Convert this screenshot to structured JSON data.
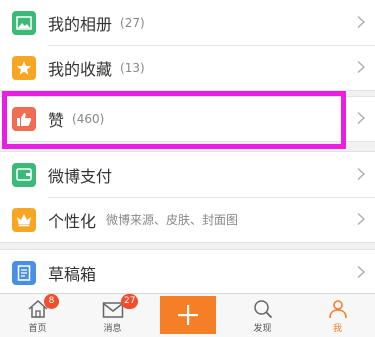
{
  "menu": {
    "album": {
      "label": "我的相册",
      "count": "(27)"
    },
    "favorites": {
      "label": "我的收藏",
      "count": "(13)"
    },
    "likes": {
      "label": "赞",
      "count": "(460)"
    },
    "payment": {
      "label": "微博支付"
    },
    "personalize": {
      "label": "个性化",
      "sub": "微博来源、皮肤、封面图"
    },
    "drafts": {
      "label": "草稿箱"
    }
  },
  "tabbar": {
    "home": {
      "label": "首页",
      "badge": "8"
    },
    "messages": {
      "label": "消息",
      "badge": "27"
    },
    "add": {
      "icon": "plus-icon"
    },
    "discover": {
      "label": "发现"
    },
    "me": {
      "label": "我"
    }
  },
  "colors": {
    "album": "#3cb878",
    "favorites": "#f6a623",
    "likes": "#ef6e53",
    "payment": "#3cb878",
    "personalize": "#f6a623",
    "drafts": "#4a90e2",
    "highlight": "#e81ee3",
    "accent": "#f47f26"
  }
}
